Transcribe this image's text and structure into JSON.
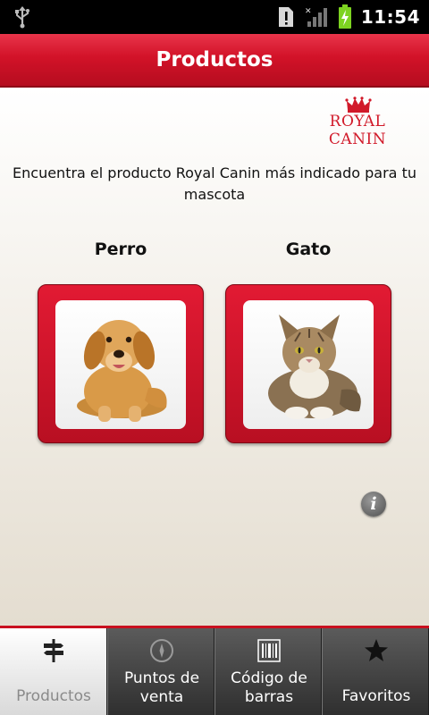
{
  "status_bar": {
    "time": "11:54"
  },
  "header": {
    "title": "Productos"
  },
  "brand": {
    "logo_text": "ROYAL CANIN"
  },
  "intro_text": "Encuentra el producto Royal Canin más indicado para tu mascota",
  "pets": [
    {
      "label": "Perro"
    },
    {
      "label": "Gato"
    }
  ],
  "info_icon_glyph": "i",
  "tabs": [
    {
      "label": "Productos",
      "icon": "signpost-icon",
      "active": true
    },
    {
      "label": "Puntos de venta",
      "icon": "compass-icon",
      "active": false
    },
    {
      "label": "Código de barras",
      "icon": "barcode-icon",
      "active": false
    },
    {
      "label": "Favoritos",
      "icon": "star-icon",
      "active": false
    }
  ],
  "colors": {
    "brand_red": "#d21228",
    "status_bar": "#000000",
    "battery_green": "#7dd321"
  }
}
